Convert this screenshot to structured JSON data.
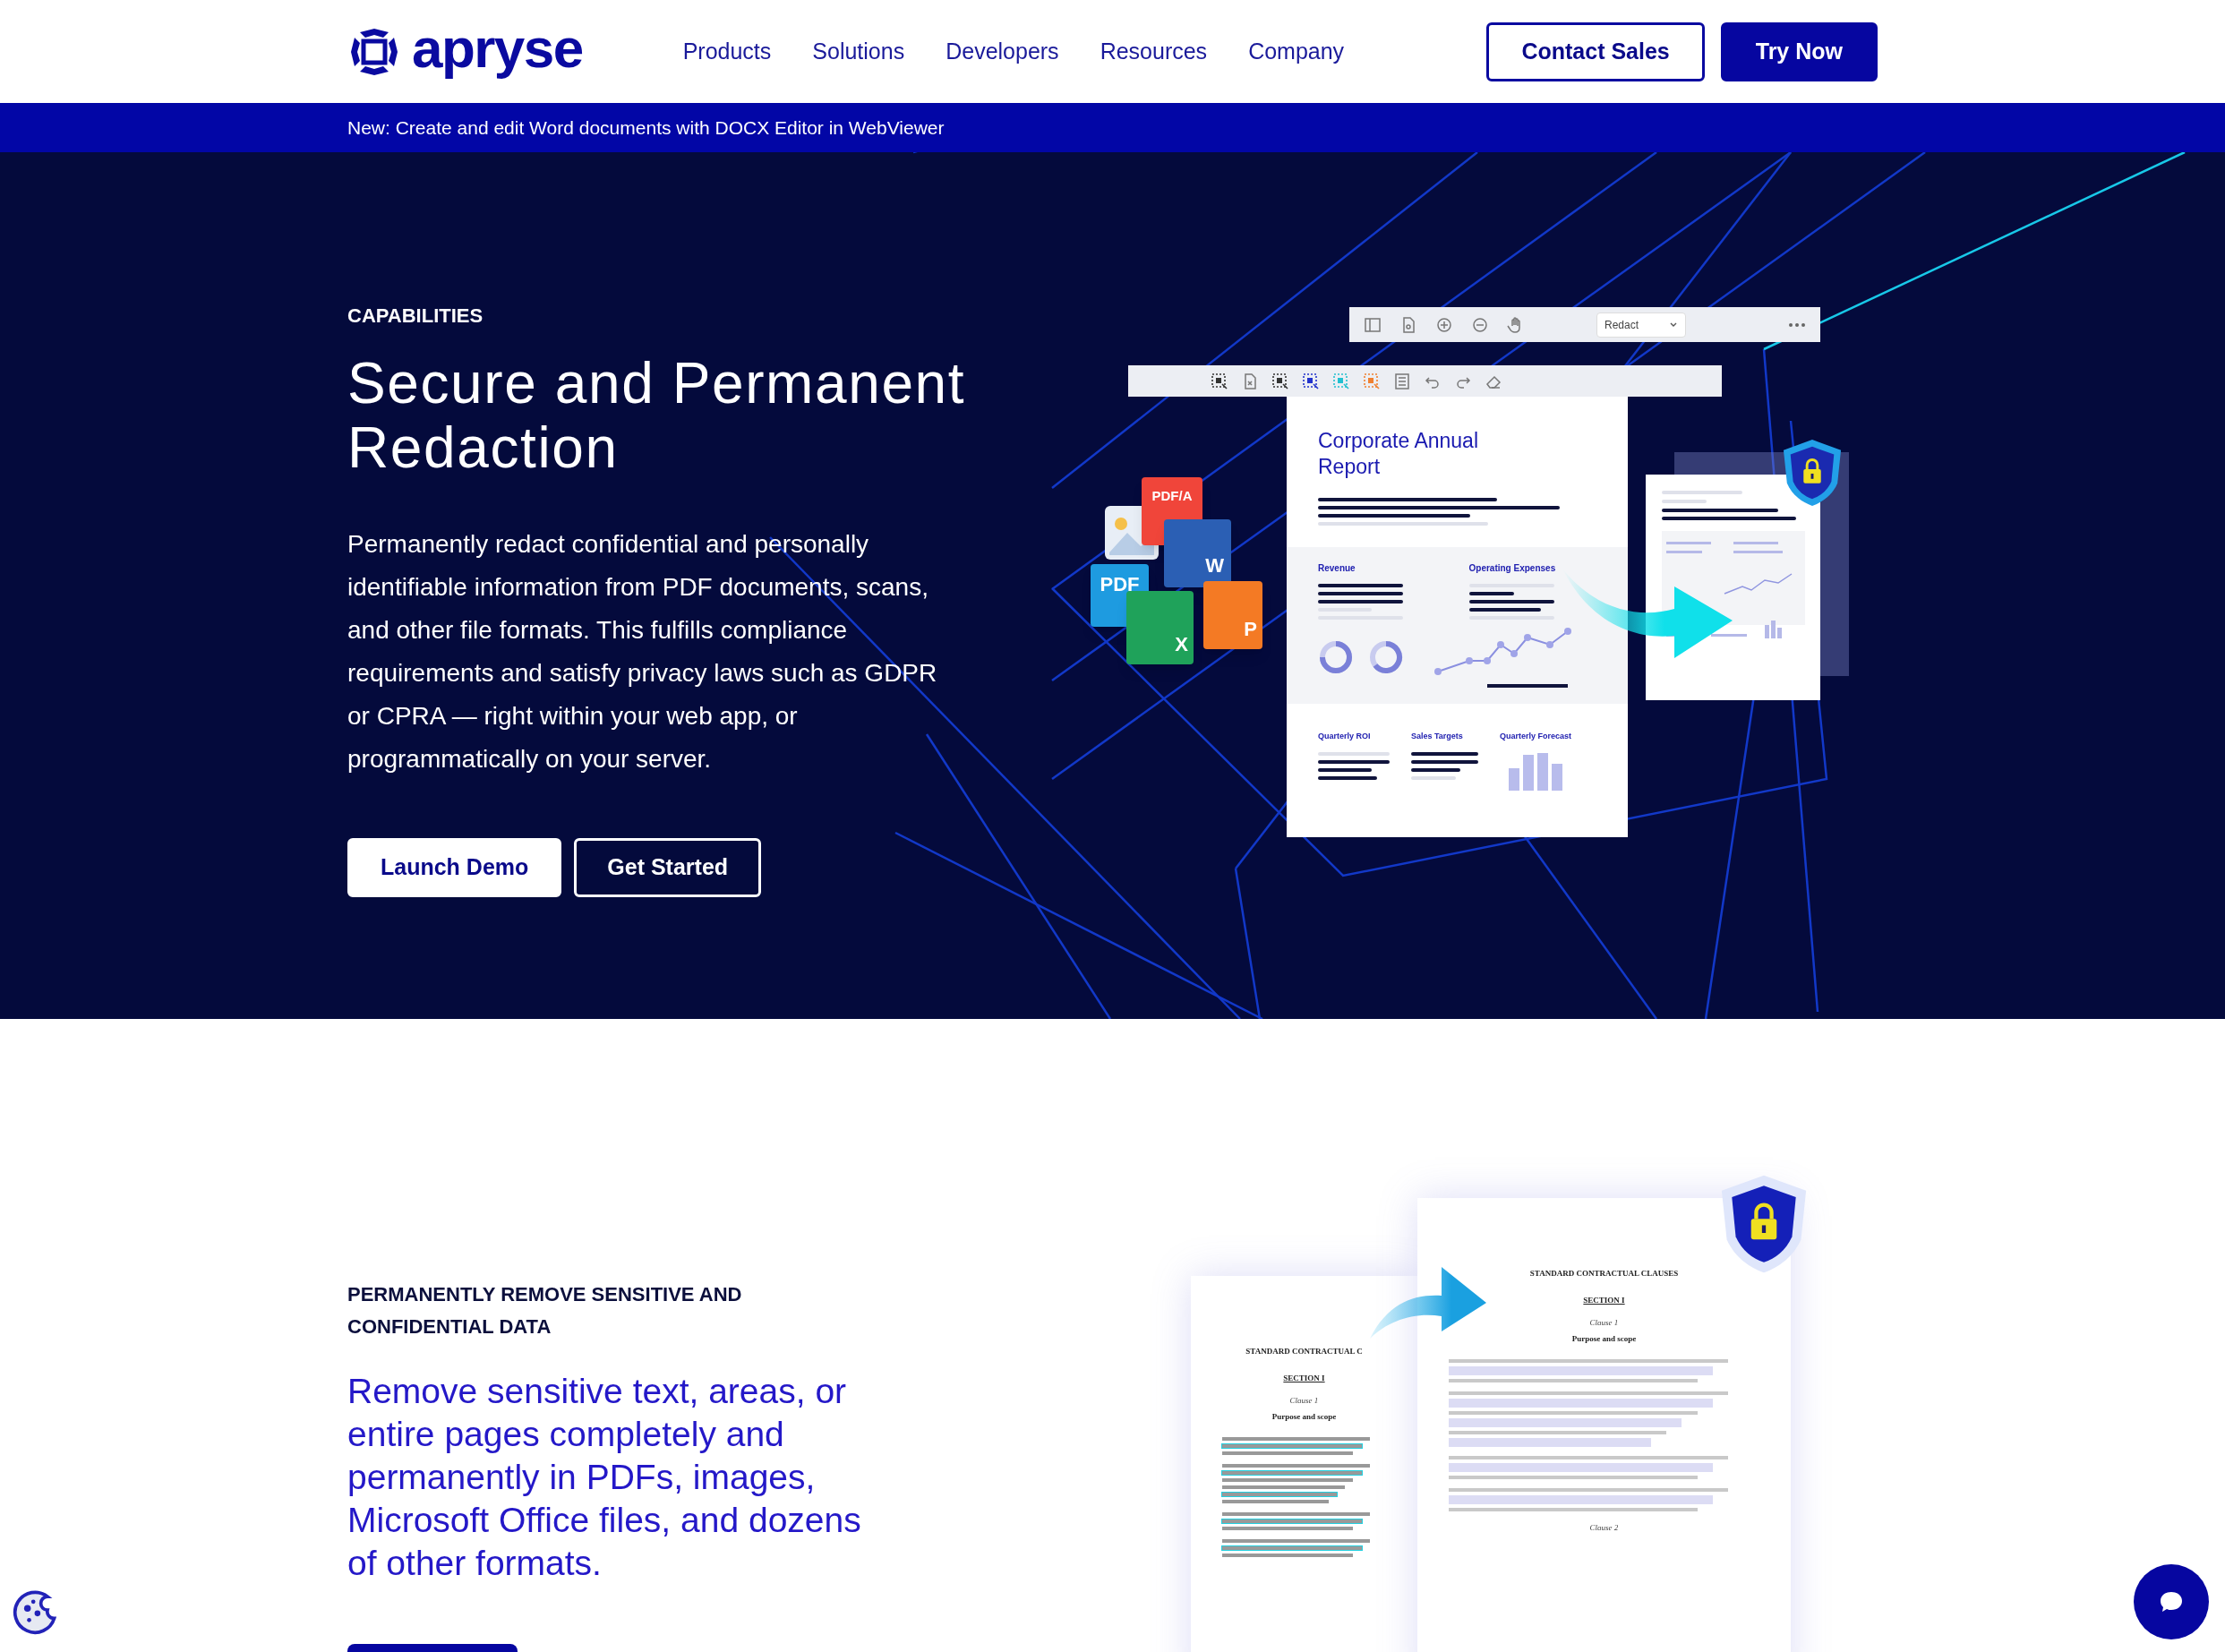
{
  "nav": {
    "logo": "apryse",
    "links": [
      "Products",
      "Solutions",
      "Developers",
      "Resources",
      "Company"
    ],
    "buttons": [
      {
        "label": "Contact Sales",
        "kind": "outline"
      },
      {
        "label": "Try Now",
        "kind": "solid"
      }
    ]
  },
  "announcement": "New: Create and edit Word documents with DOCX Editor in WebViewer",
  "hero": {
    "eyebrow": "CAPABILITIES",
    "title": "Secure and Permanent Redaction",
    "body": "Permanently redact confidential and personally identifiable information from PDF documents, scans, and other file formats. This fulfills compliance requirements and satisfy privacy laws such as GDPR or CPRA — right within your web app, or programmatically on your server.",
    "buttons": [
      {
        "label": "Launch Demo",
        "kind": "solid"
      },
      {
        "label": "Get Started",
        "kind": "outline"
      }
    ],
    "illustration": {
      "dropdown": "Redact",
      "document_title": "Corporate Annual Report",
      "section_labels": [
        "Revenue",
        "Operating Expenses"
      ],
      "bottom_labels": [
        "Quarterly ROI",
        "Sales Targets",
        "Quarterly Forecast"
      ],
      "file_badges": [
        {
          "label": "PDF/A",
          "color": "#f0453a"
        },
        {
          "label": "W",
          "color": "#2b5fb4"
        },
        {
          "label": "PDF",
          "color": "#1e9be0"
        },
        {
          "label": "X",
          "color": "#1fa25a"
        },
        {
          "label": "P",
          "color": "#f47a24"
        }
      ]
    }
  },
  "feature": {
    "eyebrow": "PERMANENTLY REMOVE SENSITIVE AND CONFIDENTIAL DATA",
    "lead": "Remove sensitive text, areas, or entire pages completely and permanently in PDFs, images, Microsoft Office files, and dozens of other formats.",
    "illustration": {
      "original_doc": {
        "heading": "STANDARD CONTRACTUAL C",
        "section": "SECTION I",
        "clause": "Clause 1",
        "subtitle": "Purpose and scope"
      },
      "redacted_doc": {
        "heading": "STANDARD CONTRACTUAL CLAUSES",
        "section": "SECTION I",
        "clause": "Clause 1",
        "subtitle": "Purpose and scope",
        "clause_2": "Clause 2"
      }
    }
  }
}
